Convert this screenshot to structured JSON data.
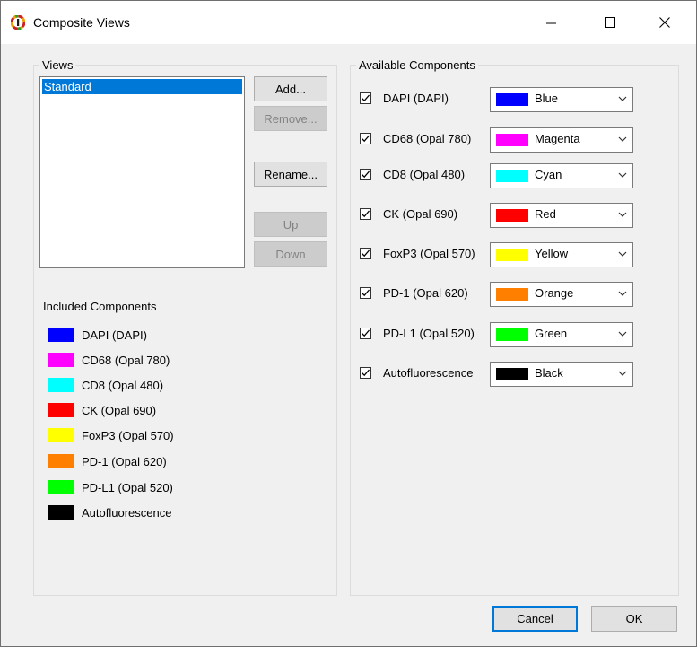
{
  "window": {
    "title": "Composite Views"
  },
  "views": {
    "group_label": "Views",
    "list": [
      "Standard"
    ],
    "buttons": {
      "add": "Add...",
      "remove": "Remove...",
      "rename": "Rename...",
      "up": "Up",
      "down": "Down"
    }
  },
  "included": {
    "label": "Included Components",
    "items": [
      {
        "name": "DAPI (DAPI)",
        "color": "#0000ff"
      },
      {
        "name": "CD68 (Opal 780)",
        "color": "#ff00ff"
      },
      {
        "name": "CD8 (Opal 480)",
        "color": "#00ffff"
      },
      {
        "name": "CK (Opal 690)",
        "color": "#ff0000"
      },
      {
        "name": "FoxP3 (Opal 570)",
        "color": "#ffff00"
      },
      {
        "name": "PD-1 (Opal 620)",
        "color": "#ff8000"
      },
      {
        "name": "PD-L1 (Opal 520)",
        "color": "#00ff00"
      },
      {
        "name": "Autofluorescence",
        "color": "#000000"
      }
    ]
  },
  "available": {
    "group_label": "Available Components",
    "items": [
      {
        "name": "DAPI (DAPI)",
        "checked": true,
        "color_name": "Blue",
        "color": "#0000ff"
      },
      {
        "name": "CD68 (Opal 780)",
        "checked": true,
        "color_name": "Magenta",
        "color": "#ff00ff"
      },
      {
        "name": "CD8 (Opal 480)",
        "checked": true,
        "color_name": "Cyan",
        "color": "#00ffff"
      },
      {
        "name": "CK (Opal 690)",
        "checked": true,
        "color_name": "Red",
        "color": "#ff0000"
      },
      {
        "name": "FoxP3 (Opal 570)",
        "checked": true,
        "color_name": "Yellow",
        "color": "#ffff00"
      },
      {
        "name": "PD-1 (Opal 620)",
        "checked": true,
        "color_name": "Orange",
        "color": "#ff8000"
      },
      {
        "name": "PD-L1 (Opal 520)",
        "checked": true,
        "color_name": "Green",
        "color": "#00ff00"
      },
      {
        "name": "Autofluorescence",
        "checked": true,
        "color_name": "Black",
        "color": "#000000"
      }
    ]
  },
  "footer": {
    "cancel": "Cancel",
    "ok": "OK"
  }
}
